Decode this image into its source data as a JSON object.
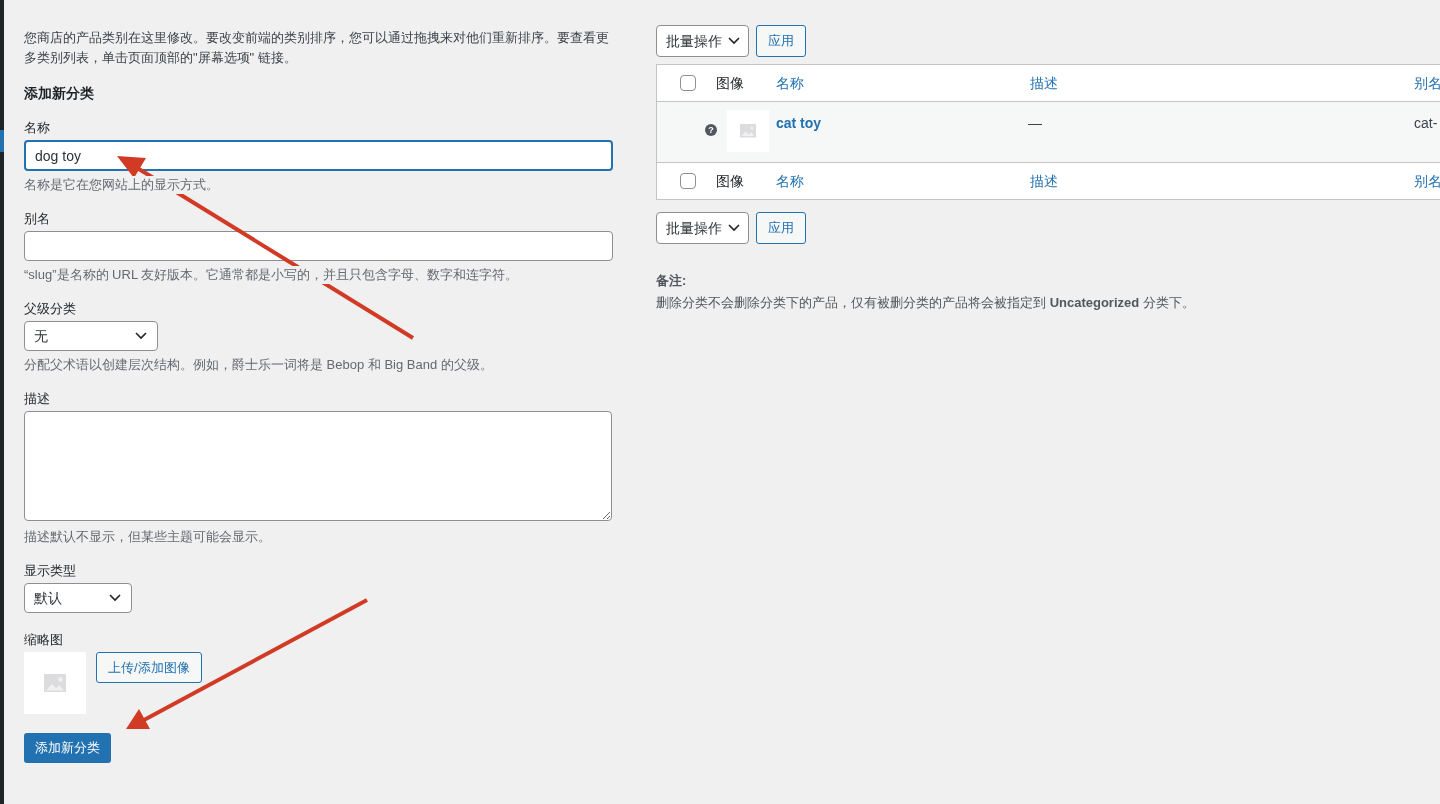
{
  "intro": "您商店的产品类别在这里修改。要改变前端的类别排序，您可以通过拖拽来对他们重新排序。要查看更多类别列表，单击页面顶部的\"屏幕选项\" 链接。",
  "form": {
    "heading": "添加新分类",
    "name": {
      "label": "名称",
      "value": "dog toy",
      "focused": true,
      "help": "名称是它在您网站上的显示方式。"
    },
    "slug": {
      "label": "别名",
      "focused": false,
      "help": "“slug”是名称的 URL 友好版本。它通常都是小写的，并且只包含字母、数字和连字符。"
    },
    "parent": {
      "label": "父级分类",
      "value": "无",
      "help": "分配父术语以创建层次结构。例如，爵士乐一词将是 Bebop 和 Big Band 的父级。"
    },
    "description": {
      "label": "描述",
      "help": "描述默认不显示，但某些主题可能会显示。"
    },
    "display_type": {
      "label": "显示类型",
      "value": "默认"
    },
    "thumbnail": {
      "label": "缩略图",
      "upload_button": "上传/添加图像"
    },
    "submit": "添加新分类"
  },
  "bulk_top": {
    "select": "批量操作",
    "apply": "应用"
  },
  "table": {
    "header": [
      {
        "label": "图像",
        "kind": "plain"
      },
      {
        "label": "名称",
        "kind": "link"
      },
      {
        "label": "描述",
        "kind": "link"
      },
      {
        "label": "别名",
        "kind": "link"
      }
    ],
    "header_checked": false,
    "rows": [
      {
        "status_icon": "?",
        "name": "cat toy",
        "description": "—",
        "slug": "cat-"
      }
    ],
    "footer": [
      {
        "label": "图像",
        "kind": "plain"
      },
      {
        "label": "名称",
        "kind": "link"
      },
      {
        "label": "描述",
        "kind": "link"
      },
      {
        "label": "别名",
        "kind": "link"
      }
    ],
    "footer_checked": false
  },
  "bulk_bottom": {
    "select": "批量操作",
    "apply": "应用"
  },
  "note": {
    "title": "备注:",
    "text": "删除分类不会删除分类下的产品，仅有被删分类的产品将会被指定到 **Uncategorized** 分类下。"
  }
}
